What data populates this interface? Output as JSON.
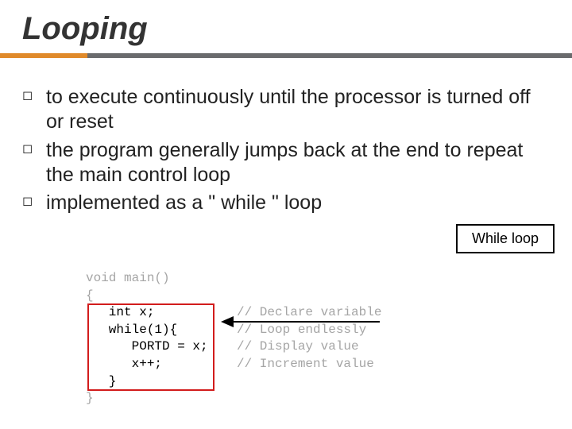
{
  "title": "Looping",
  "bullets": [
    "to execute continuously until the processor is turned off or reset",
    "the program generally jumps back at the end to repeat the main control loop",
    "implemented as a \" while \" loop"
  ],
  "callout": "While loop",
  "code": {
    "l0": "void main()",
    "l1": "{",
    "l2": "   int x;",
    "l3": "   while(1){",
    "l4": "      PORTD = x;",
    "l5": "      x++;",
    "l6": "   }",
    "l7": "}",
    "c2": "// Declare variable",
    "c3": "// Loop endlessly",
    "c4": "// Display value",
    "c5": "// Increment value"
  }
}
